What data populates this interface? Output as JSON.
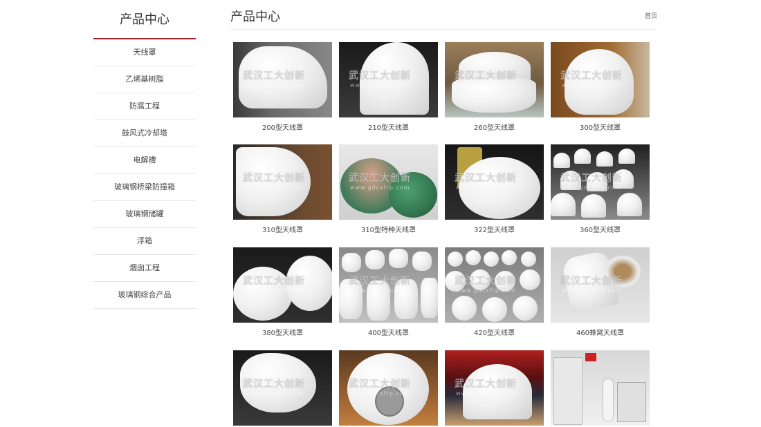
{
  "sidebar": {
    "title": "产品中心",
    "items": [
      {
        "label": "天线罩"
      },
      {
        "label": "乙烯基树脂"
      },
      {
        "label": "防腐工程"
      },
      {
        "label": "鼓风式冷却塔"
      },
      {
        "label": "电解槽"
      },
      {
        "label": "玻璃钢桥梁防撞箱"
      },
      {
        "label": "玻璃钢储罐"
      },
      {
        "label": "浮箱"
      },
      {
        "label": "烟囱工程"
      },
      {
        "label": "玻璃钢综合产品"
      }
    ]
  },
  "main": {
    "title": "产品中心",
    "breadcrumb": "首页"
  },
  "watermark": {
    "text": "武汉工大创新",
    "url": "www.gdcxfrp.com"
  },
  "products": [
    {
      "caption": "200型天线罩",
      "icon": "radome-photo"
    },
    {
      "caption": "210型天线罩",
      "icon": "radome-photo"
    },
    {
      "caption": "260型天线罩",
      "icon": "radome-photo"
    },
    {
      "caption": "300型天线罩",
      "icon": "radome-photo"
    },
    {
      "caption": "310型天线罩",
      "icon": "radome-photo"
    },
    {
      "caption": "310型特种天线罩",
      "icon": "radome-photo"
    },
    {
      "caption": "322型天线罩",
      "icon": "radome-photo"
    },
    {
      "caption": "360型天线罩",
      "icon": "radome-photo"
    },
    {
      "caption": "380型天线罩",
      "icon": "radome-photo"
    },
    {
      "caption": "400型天线罩",
      "icon": "radome-photo"
    },
    {
      "caption": "420型天线罩",
      "icon": "radome-photo"
    },
    {
      "caption": "460蜂窝天线罩",
      "icon": "radome-photo"
    },
    {
      "caption": "",
      "icon": "radome-photo"
    },
    {
      "caption": "",
      "icon": "radome-photo"
    },
    {
      "caption": "",
      "icon": "radome-photo"
    },
    {
      "caption": "",
      "icon": "radome-photo"
    }
  ],
  "colors": {
    "accent": "#a1232b",
    "divider": "#e6e6e6"
  }
}
